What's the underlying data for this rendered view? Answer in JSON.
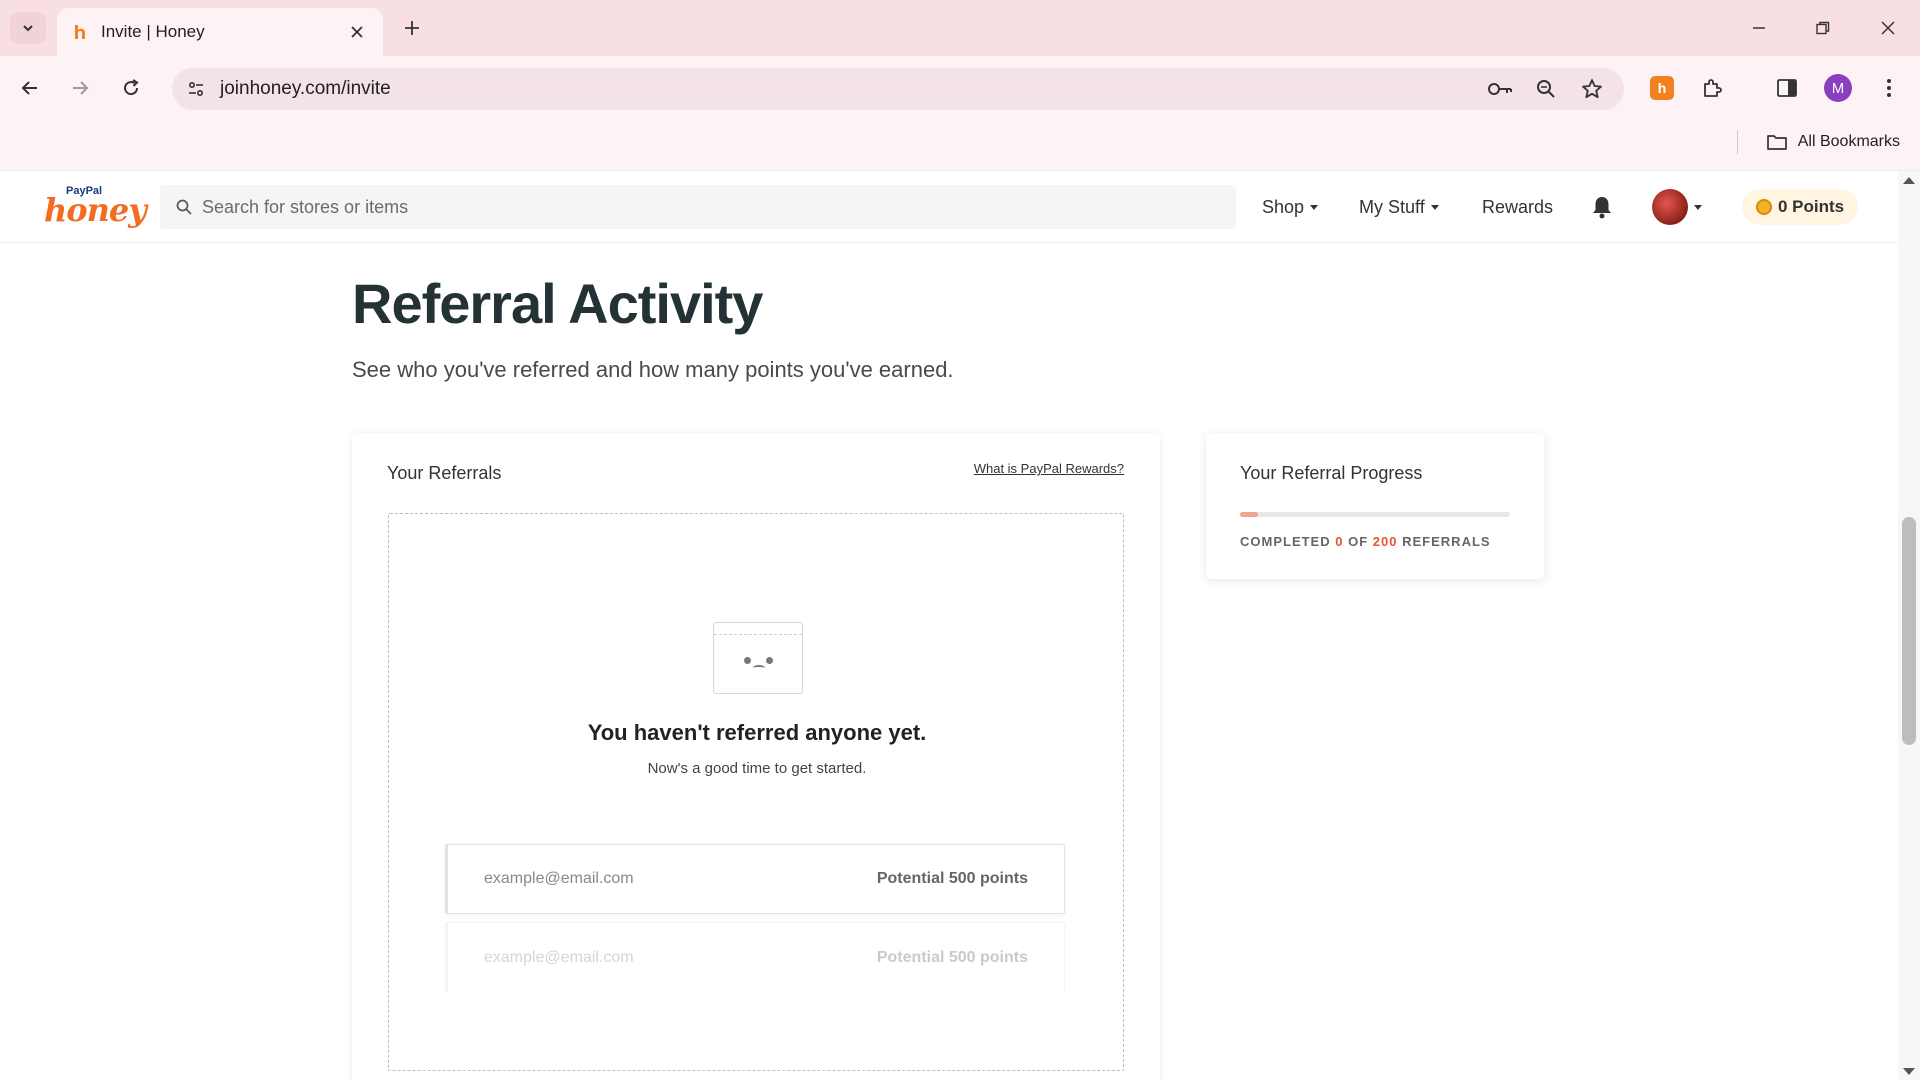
{
  "browser": {
    "tab_title": "Invite | Honey",
    "url": "joinhoney.com/invite",
    "bookmarks_label": "All Bookmarks",
    "profile_initial": "M",
    "extension_letter": "h"
  },
  "honey": {
    "logo_paypal": "PayPal",
    "logo_honey": "honey",
    "search_placeholder": "Search for stores or items",
    "nav": {
      "shop": "Shop",
      "my_stuff": "My Stuff",
      "rewards": "Rewards"
    },
    "points_label": "0 Points"
  },
  "page": {
    "title": "Referral Activity",
    "subtitle": "See who you've referred and how many points you've earned."
  },
  "referrals_card": {
    "title": "Your Referrals",
    "link": "What is PayPal Rewards?",
    "empty_title": "You haven't referred anyone yet.",
    "empty_subtitle": "Now's a good time to get started.",
    "example_rows": [
      {
        "email": "example@email.com",
        "points": "Potential 500 points"
      },
      {
        "email": "example@email.com",
        "points": "Potential 500 points"
      }
    ]
  },
  "progress_card": {
    "title": "Your Referral Progress",
    "completed_prefix": "COMPLETED",
    "completed_count": "0",
    "of_word": "OF",
    "total": "200",
    "suffix": "REFERRALS",
    "fraction": 0
  },
  "colors": {
    "tabstrip": "#f8dfe4",
    "honey_orange": "#f26c22",
    "accent_red": "#e8552e"
  }
}
